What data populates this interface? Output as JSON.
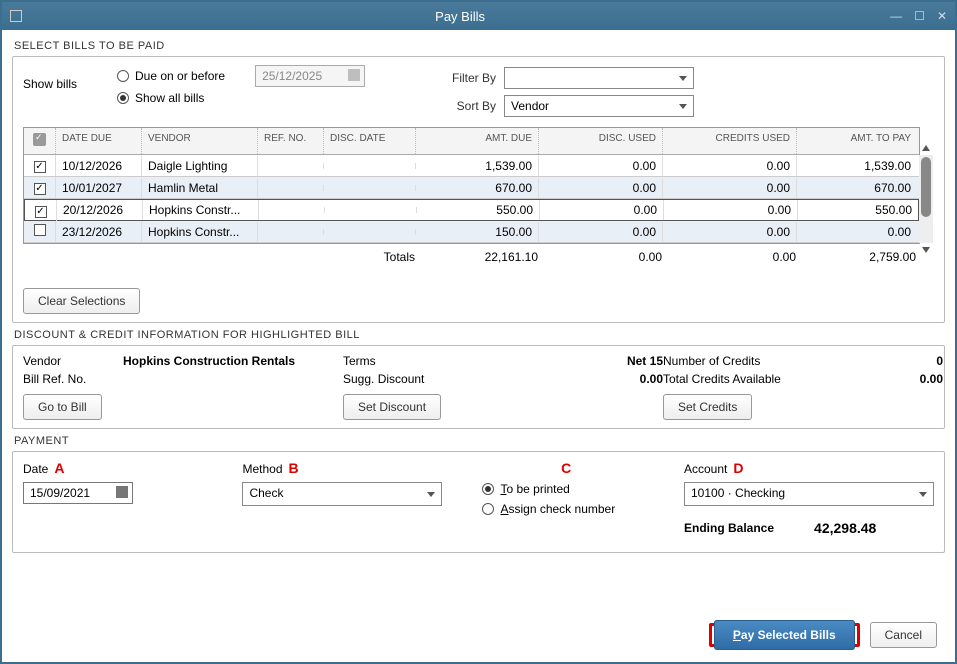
{
  "window": {
    "title": "Pay Bills"
  },
  "select_bills": {
    "section_label": "SELECT BILLS TO BE PAID",
    "show_bills_label": "Show bills",
    "due_on_label": "Due on or before",
    "due_on_date": "25/12/2025",
    "show_all_label": "Show all bills",
    "filter_by_label": "Filter By",
    "filter_by_value": "",
    "sort_by_label": "Sort By",
    "sort_by_value": "Vendor"
  },
  "table": {
    "headers": {
      "date_due": "DATE DUE",
      "vendor": "VENDOR",
      "ref_no": "REF. NO.",
      "disc_date": "DISC. DATE",
      "amt_due": "AMT. DUE",
      "disc_used": "DISC. USED",
      "credits_used": "CREDITS USED",
      "amt_to_pay": "AMT. TO PAY"
    },
    "rows": [
      {
        "checked": true,
        "date_due": "10/12/2026",
        "vendor": "Daigle Lighting",
        "ref_no": "",
        "disc_date": "",
        "amt_due": "1,539.00",
        "disc_used": "0.00",
        "credits_used": "0.00",
        "amt_to_pay": "1,539.00"
      },
      {
        "checked": true,
        "date_due": "10/01/2027",
        "vendor": "Hamlin Metal",
        "ref_no": "",
        "disc_date": "",
        "amt_due": "670.00",
        "disc_used": "0.00",
        "credits_used": "0.00",
        "amt_to_pay": "670.00"
      },
      {
        "checked": true,
        "date_due": "20/12/2026",
        "vendor": "Hopkins Constr...",
        "ref_no": "",
        "disc_date": "",
        "amt_due": "550.00",
        "disc_used": "0.00",
        "credits_used": "0.00",
        "amt_to_pay": "550.00"
      },
      {
        "checked": false,
        "date_due": "23/12/2026",
        "vendor": "Hopkins Constr...",
        "ref_no": "",
        "disc_date": "",
        "amt_due": "150.00",
        "disc_used": "0.00",
        "credits_used": "0.00",
        "amt_to_pay": "0.00"
      }
    ],
    "totals": {
      "label": "Totals",
      "amt_due": "22,161.10",
      "disc_used": "0.00",
      "credits_used": "0.00",
      "amt_to_pay": "2,759.00"
    }
  },
  "clear_selections_label": "Clear Selections",
  "discount_info": {
    "section_label": "DISCOUNT & CREDIT INFORMATION FOR HIGHLIGHTED BILL",
    "vendor_label": "Vendor",
    "vendor_value": "Hopkins Construction Rentals",
    "terms_label": "Terms",
    "terms_value": "Net 15",
    "num_credits_label": "Number of Credits",
    "num_credits_value": "0",
    "ref_label": "Bill Ref. No.",
    "ref_value": "",
    "sugg_disc_label": "Sugg. Discount",
    "sugg_disc_value": "0.00",
    "total_credits_label": "Total Credits Available",
    "total_credits_value": "0.00",
    "go_to_bill": "Go to Bill",
    "set_discount": "Set Discount",
    "set_credits": "Set Credits"
  },
  "payment": {
    "section_label": "PAYMENT",
    "date_label": "Date",
    "date_value": "15/09/2021",
    "method_label": "Method",
    "method_value": "Check",
    "to_be_printed": "To be printed",
    "assign_check": "Assign check number",
    "account_label": "Account",
    "account_value": "10100 · Checking",
    "ending_balance_label": "Ending Balance",
    "ending_balance_value": "42,298.48",
    "letters": {
      "a": "A",
      "b": "B",
      "c": "C",
      "d": "D"
    }
  },
  "footer": {
    "pay": "Pay Selected Bills",
    "cancel": "Cancel"
  }
}
